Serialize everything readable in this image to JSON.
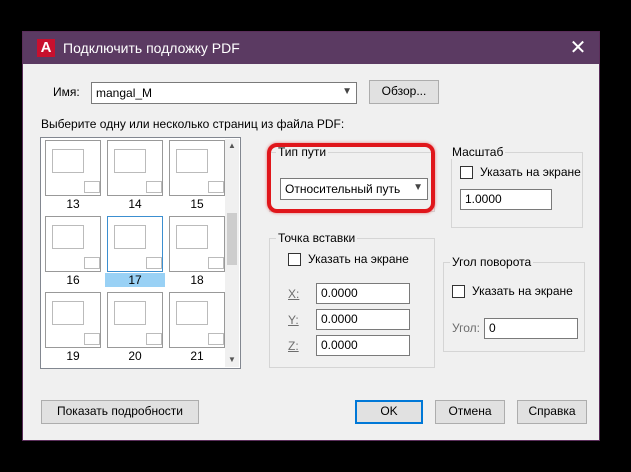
{
  "window": {
    "title": "Подключить подложку PDF",
    "app_icon": "A",
    "close_glyph": "✕"
  },
  "name_row": {
    "label": "Имя:",
    "value": "mangal_M",
    "browse_label": "Обзор..."
  },
  "pages": {
    "prompt": "Выберите одну или несколько страниц из файла PDF:",
    "thumbnails": [
      {
        "num": "13",
        "selected": false
      },
      {
        "num": "14",
        "selected": false
      },
      {
        "num": "15",
        "selected": false
      },
      {
        "num": "16",
        "selected": false
      },
      {
        "num": "17",
        "selected": true
      },
      {
        "num": "18",
        "selected": false
      },
      {
        "num": "19",
        "selected": false
      },
      {
        "num": "20",
        "selected": false
      },
      {
        "num": "21",
        "selected": false
      }
    ]
  },
  "path_type": {
    "title": "Тип пути",
    "value": "Относительный путь"
  },
  "scale": {
    "title": "Масштаб",
    "on_screen_label": "Указать на экране",
    "value": "1.0000"
  },
  "insertion": {
    "title": "Точка вставки",
    "on_screen_label": "Указать на экране",
    "x_label": "X:",
    "y_label": "Y:",
    "z_label": "Z:",
    "x": "0.0000",
    "y": "0.0000",
    "z": "0.0000"
  },
  "rotation": {
    "title": "Угол поворота",
    "on_screen_label": "Указать на экране",
    "angle_label": "Угол:",
    "angle": "0"
  },
  "buttons": {
    "details": "Показать подробности",
    "ok": "OK",
    "cancel": "Отмена",
    "help": "Справка"
  },
  "colors": {
    "titlebar": "#5b3a62",
    "highlight": "#e0161b",
    "selection": "#99d1f5"
  }
}
